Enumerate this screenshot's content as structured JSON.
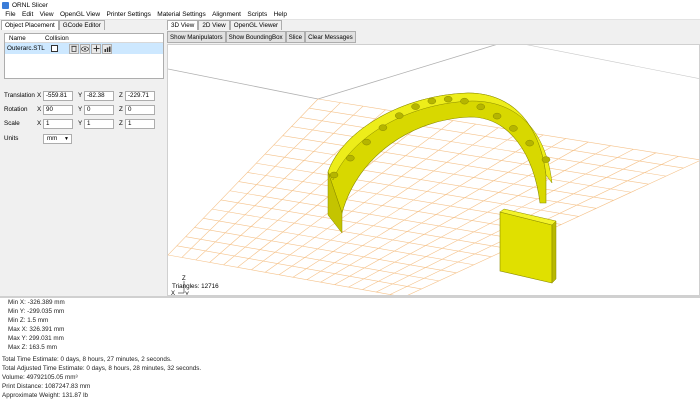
{
  "window": {
    "title": "ORNL Slicer"
  },
  "menu": [
    "File",
    "Edit",
    "View",
    "OpenGL View",
    "Printer Settings",
    "Material Settings",
    "Alignment",
    "Scripts",
    "Help"
  ],
  "left_tabs": [
    "Object Placement",
    "GCode Editor"
  ],
  "object_table": {
    "headers": [
      "Name",
      "Collision"
    ],
    "row": {
      "name": "Outerarc.STL"
    }
  },
  "transform": {
    "translation": {
      "label": "Translation",
      "x": "-559.81",
      "y": "-82.38",
      "z": "-229.71"
    },
    "rotation": {
      "label": "Rotation",
      "x": "90",
      "y": "0",
      "z": "0"
    },
    "scale": {
      "label": "Scale",
      "x": "1",
      "y": "1",
      "z": "1"
    },
    "units": {
      "label": "Units",
      "value": "mm"
    }
  },
  "axes": {
    "x": "X",
    "y": "Y",
    "z": "Z"
  },
  "view_tabs": [
    "3D View",
    "2D View",
    "OpenGL Viewer"
  ],
  "view_buttons": [
    "Show Manipulators",
    "Show BoundingBox",
    "Slice",
    "Clear Messages"
  ],
  "viewport": {
    "triangles": "Triangles: 12716",
    "model_color": "#e5e500",
    "grid_color": "#f5c28a"
  },
  "output": [
    "Min X: -326.389 mm",
    "Min Y: -299.035 mm",
    "Min Z: 1.5 mm",
    "Max X: 326.391 mm",
    "Max Y: 299.031 mm",
    "Max Z: 163.5 mm",
    "Total Time Estimate: 0 days, 8 hours, 27 minutes, 2 seconds.",
    "Total Adjusted Time Estimate: 0 days, 8 hours, 28 minutes, 32 seconds.",
    "Volume: 49792105.05 mm³",
    "Print Distance: 1087247.83 mm",
    "Approximate Weight: 131.87 lb"
  ]
}
